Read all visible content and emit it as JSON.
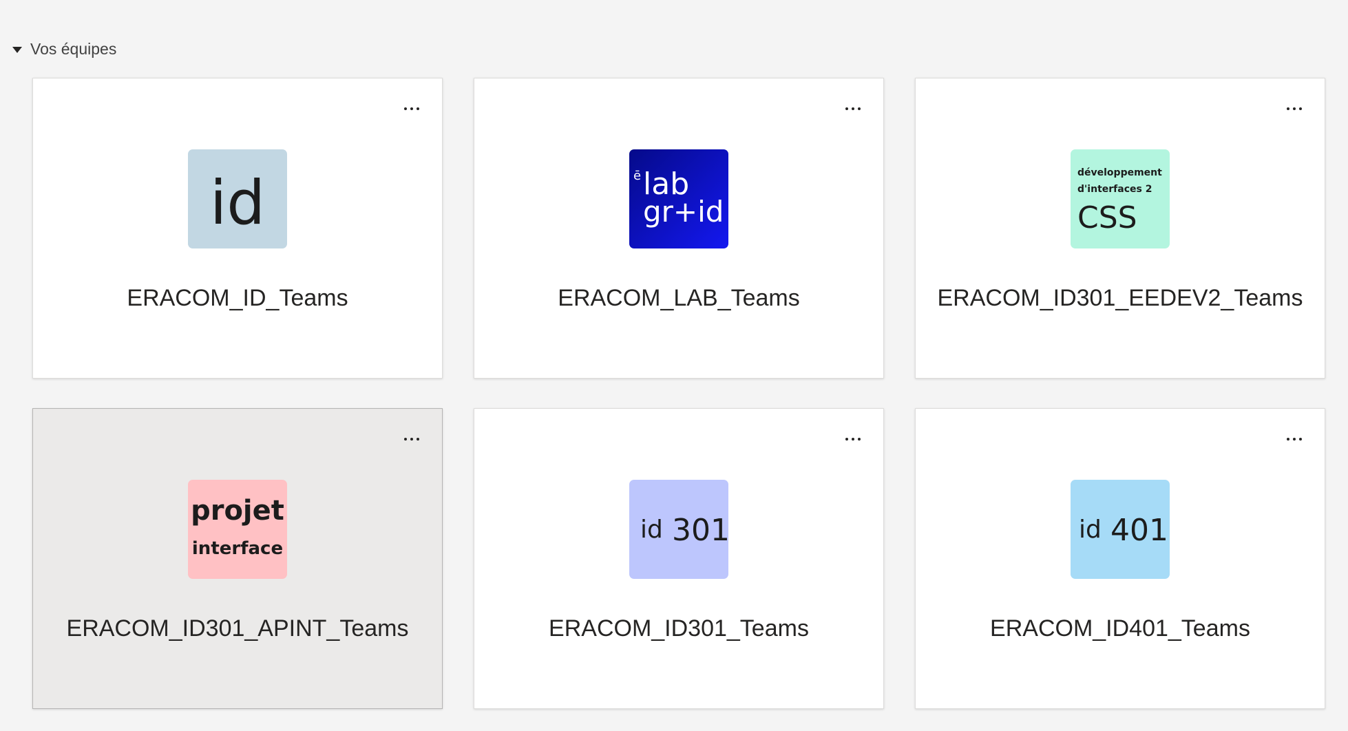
{
  "section": {
    "title": "Vos équipes"
  },
  "teams": [
    {
      "name": "ERACOM_ID_Teams",
      "logo": {
        "icon": "id-logo",
        "background": "#c2d7e3",
        "lines": [
          "id"
        ]
      }
    },
    {
      "name": "ERACOM_LAB_Teams",
      "logo": {
        "icon": "lab-grid-logo",
        "background": "#0a0fc6",
        "lines": [
          "ē",
          "lab",
          "gr+id"
        ]
      }
    },
    {
      "name": "ERACOM_ID301_EEDEV2_Teams",
      "logo": {
        "icon": "css-logo",
        "background": "#b3f5df",
        "lines": [
          "développement",
          "d'interfaces 2",
          "CSS"
        ]
      }
    },
    {
      "name": "ERACOM_ID301_APINT_Teams",
      "logo": {
        "icon": "projet-interface-logo",
        "background": "#ffc1c4",
        "lines": [
          "projet",
          "interface"
        ]
      },
      "hovered": true
    },
    {
      "name": "ERACOM_ID301_Teams",
      "logo": {
        "icon": "id301-logo",
        "background": "#bdc6fd",
        "lines": [
          "id",
          "301"
        ]
      }
    },
    {
      "name": "ERACOM_ID401_Teams",
      "logo": {
        "icon": "id401-logo",
        "background": "#a6dbf7",
        "lines": [
          "id",
          "401"
        ]
      }
    }
  ]
}
